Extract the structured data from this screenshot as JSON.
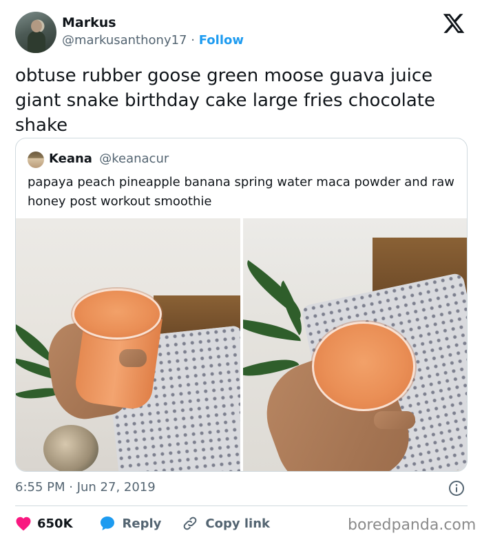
{
  "tweet": {
    "author_name": "Markus",
    "author_handle": "@markusanthony17",
    "separator": "·",
    "follow_label": "Follow",
    "text": "obtuse rubber goose green moose guava juice giant snake birthday cake large fries chocolate shake",
    "timestamp": "6:55 PM · Jun 27, 2019"
  },
  "quote": {
    "author_name": "Keana",
    "author_handle": "@keanacur",
    "text": "papaya peach pineapple banana spring water maca powder and raw honey post workout smoothie"
  },
  "actions": {
    "likes": "650K",
    "reply_label": "Reply",
    "copy_link_label": "Copy link"
  },
  "watermark": "boredpanda.com",
  "colors": {
    "accent": "#1d9bf0",
    "like": "#f91880",
    "text": "#0f1419",
    "muted": "#536471",
    "border": "#cfd9de"
  },
  "icons": [
    "x-logo-icon",
    "info-icon",
    "heart-icon",
    "reply-bubble-icon",
    "link-icon"
  ]
}
